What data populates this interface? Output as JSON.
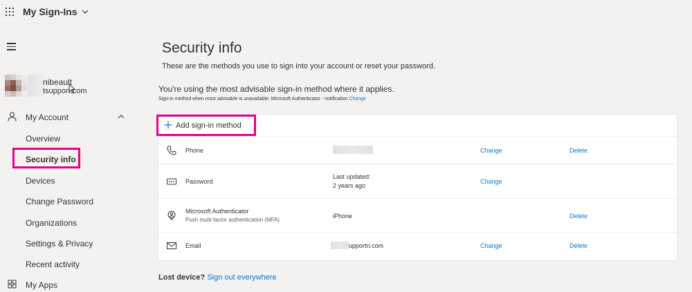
{
  "header": {
    "app_title": "My Sign-Ins",
    "icons": [
      "waffle-icon",
      "chevron-down-icon"
    ]
  },
  "user": {
    "name_visible": "nibeault",
    "email_visible": "tsupport.com"
  },
  "sidebar": {
    "account_label": "My Account",
    "items": [
      {
        "label": "Overview"
      },
      {
        "label": "Security info"
      },
      {
        "label": "Devices"
      },
      {
        "label": "Change Password"
      },
      {
        "label": "Organizations"
      },
      {
        "label": "Settings & Privacy"
      },
      {
        "label": "Recent activity"
      }
    ],
    "apps_label": "My Apps"
  },
  "main": {
    "title": "Security info",
    "subtitle": "These are the methods you use to sign into your account or reset your password.",
    "advisable": "You're using the most advisable sign-in method where it applies.",
    "advisable_note": "Sign-in method when most advisable is unavailable: Microsoft Authenticator - notification",
    "advisable_change": "Change",
    "add_method": "Add sign-in method",
    "methods": [
      {
        "name": "Phone",
        "value": "",
        "change": "Change",
        "delete": "Delete",
        "icon": "phone-icon"
      },
      {
        "name": "Password",
        "value_line1": "Last updated:",
        "value_line2": "2 years ago",
        "change": "Change",
        "icon": "password-icon"
      },
      {
        "name": "Microsoft Authenticator",
        "detail": "Push multi-factor authentication (MFA)",
        "value": "iPhone",
        "delete": "Delete",
        "icon": "authenticator-icon"
      },
      {
        "name": "Email",
        "value": "upportri.com",
        "change": "Change",
        "delete": "Delete",
        "icon": "mail-icon"
      }
    ],
    "lost_device": "Lost device?",
    "sign_out": "Sign out everywhere"
  },
  "colors": {
    "accent": "#0078d4",
    "highlight": "#e3008c",
    "background": "#f3f2f1"
  }
}
